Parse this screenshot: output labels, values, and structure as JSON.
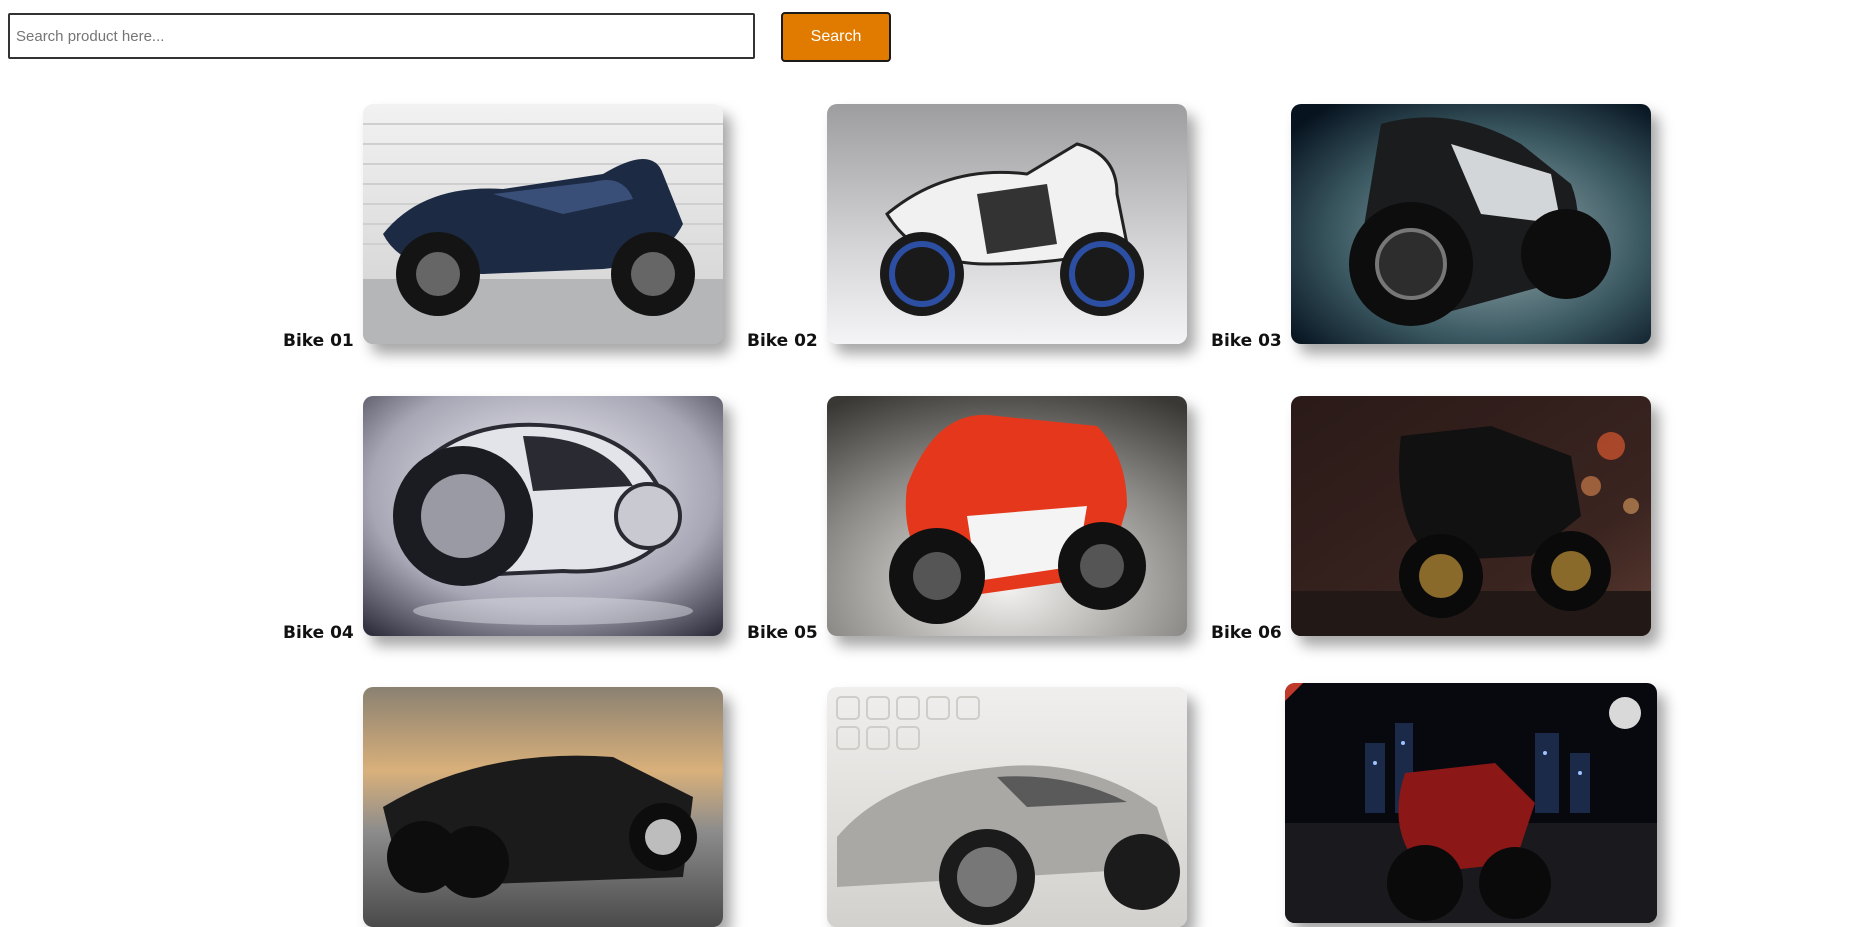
{
  "search": {
    "placeholder": "Search product here...",
    "value": "",
    "button_label": "Search"
  },
  "accent_color": "#e07b00",
  "products": [
    {
      "label": "Bike 01",
      "image": "dark blue sport motorcycle"
    },
    {
      "label": "Bike 02",
      "image": "white and black sport motorcycle"
    },
    {
      "label": "Bike 03",
      "image": "black futuristic motorcycle"
    },
    {
      "label": "Bike 04",
      "image": "silver futuristic light-cycle"
    },
    {
      "label": "Bike 05",
      "image": "red racing motorcycle"
    },
    {
      "label": "Bike 06",
      "image": "black sport motorcycle at night"
    },
    {
      "label": "",
      "image": "armored black concept vehicle"
    },
    {
      "label": "",
      "image": "silver concept car"
    },
    {
      "label": "",
      "image": "red motorcycle in night city"
    }
  ]
}
